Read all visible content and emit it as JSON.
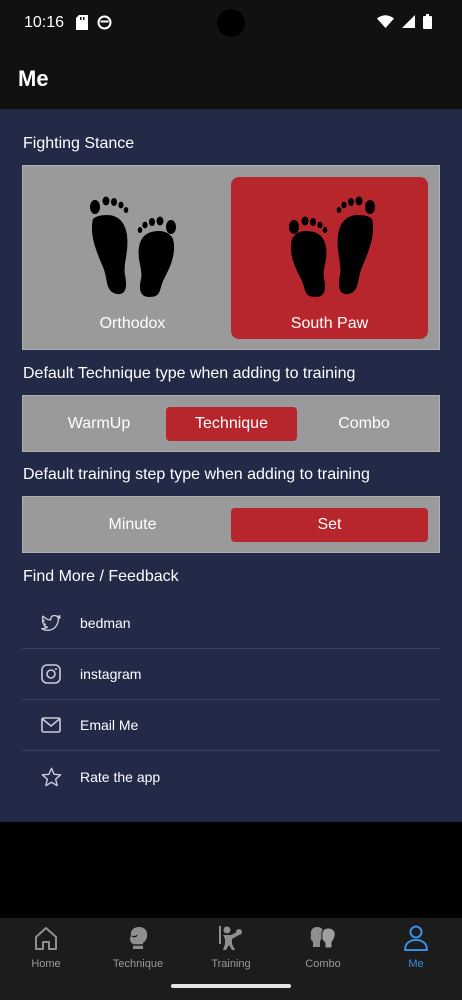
{
  "status_bar": {
    "time": "10:16"
  },
  "app_bar": {
    "title": "Me"
  },
  "fighting_stance": {
    "title": "Fighting Stance",
    "options": [
      {
        "label": "Orthodox",
        "icon": "feet-icon",
        "selected": false
      },
      {
        "label": "South Paw",
        "icon": "feet-icon",
        "selected": true
      }
    ]
  },
  "technique_type": {
    "title": "Default Technique type when adding to training",
    "options": [
      "WarmUp",
      "Technique",
      "Combo"
    ],
    "selected": "Technique"
  },
  "step_type": {
    "title": "Default training step type when adding to training",
    "options": [
      "Minute",
      "Set"
    ],
    "selected": "Set"
  },
  "feedback": {
    "title": "Find More / Feedback",
    "links": [
      {
        "label": "bedman",
        "icon": "twitter-icon"
      },
      {
        "label": "instagram",
        "icon": "instagram-icon"
      },
      {
        "label": "Email Me",
        "icon": "mail-icon"
      },
      {
        "label": "Rate the app",
        "icon": "star-icon"
      }
    ]
  },
  "bottom_nav": {
    "items": [
      {
        "label": "Home",
        "icon": "home-icon"
      },
      {
        "label": "Technique",
        "icon": "boxing-glove-icon"
      },
      {
        "label": "Training",
        "icon": "boxer-training-icon"
      },
      {
        "label": "Combo",
        "icon": "boxing-gloves-pair-icon"
      },
      {
        "label": "Me",
        "icon": "person-icon",
        "active": true
      }
    ]
  },
  "colors": {
    "accent_red": "#b7262c",
    "background_navy": "#222a48",
    "active_blue": "#3a8ee6"
  }
}
